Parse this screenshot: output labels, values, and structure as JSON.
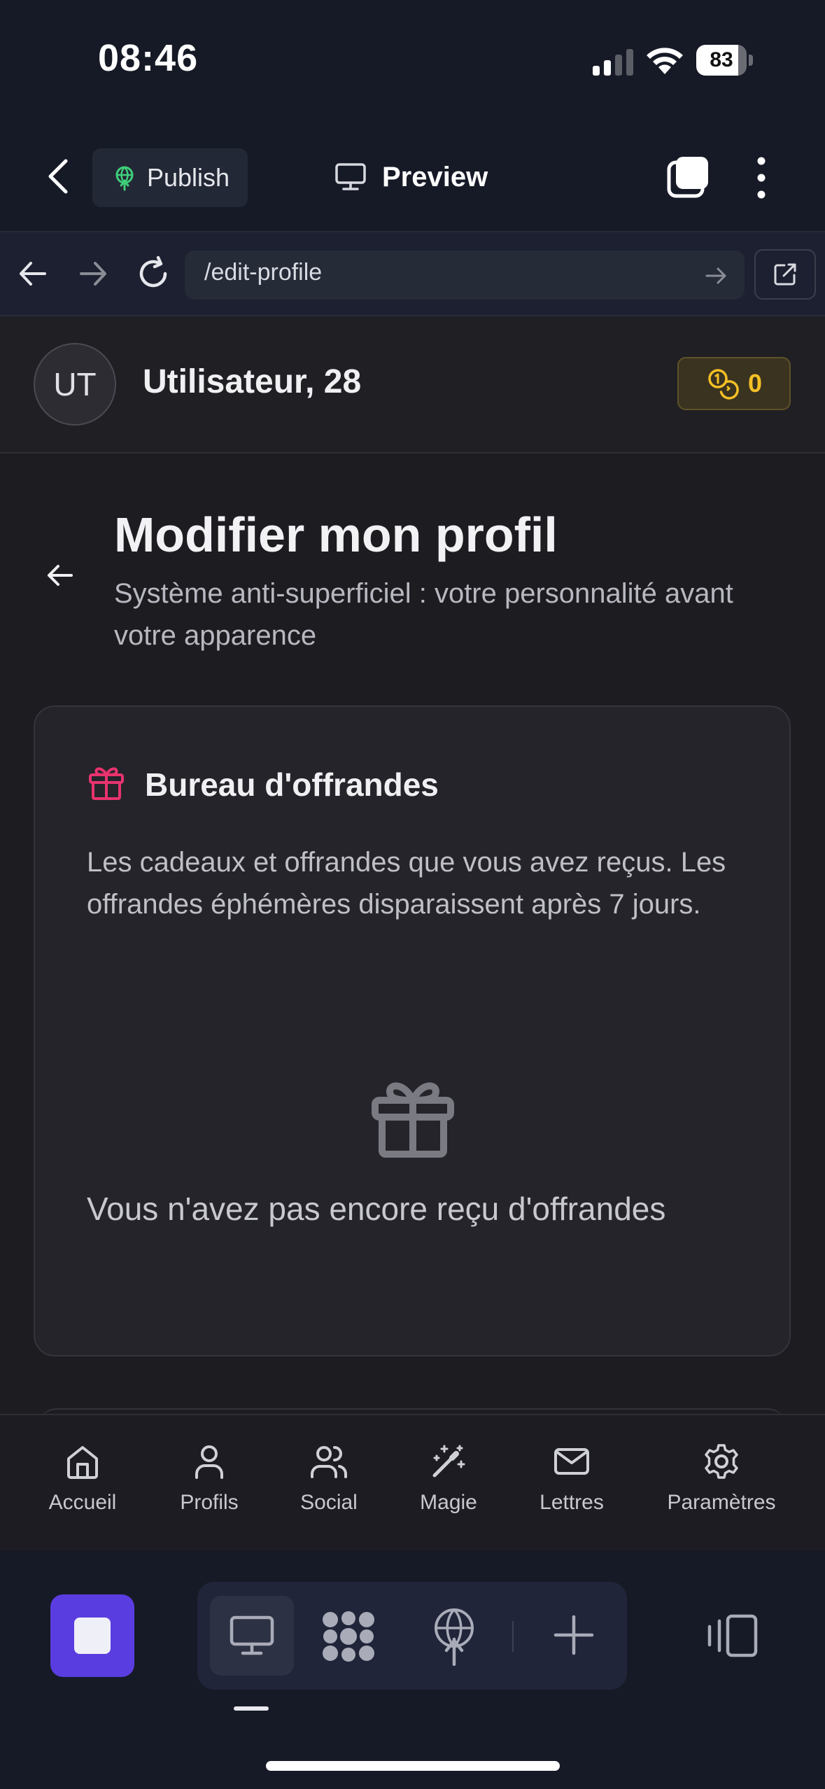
{
  "status": {
    "time": "08:46",
    "battery": "83",
    "battery_level": 0.83
  },
  "header": {
    "publish_label": "Publish",
    "preview_label": "Preview"
  },
  "browser": {
    "url": "/edit-profile"
  },
  "user": {
    "initials": "UT",
    "name": "Utilisateur, 28",
    "coins": "0"
  },
  "page": {
    "title": "Modifier mon profil",
    "subtitle": "Système anti-superficiel : votre personnalité avant votre apparence"
  },
  "card": {
    "title": "Bureau d'offrandes",
    "description": "Les cadeaux et offrandes que vous avez reçus. Les offrandes éphémères disparaissent après 7 jours.",
    "empty_text": "Vous n'avez pas encore reçu d'offrandes"
  },
  "nav": {
    "items": [
      {
        "label": "Accueil",
        "icon": "home-icon"
      },
      {
        "label": "Profils",
        "icon": "user-icon"
      },
      {
        "label": "Social",
        "icon": "users-icon"
      },
      {
        "label": "Magie",
        "icon": "magic-wand-icon"
      },
      {
        "label": "Lettres",
        "icon": "mail-icon"
      },
      {
        "label": "Paramètres",
        "icon": "gear-icon"
      }
    ]
  },
  "colors": {
    "accent_purple": "#5a3de0",
    "gift_pink": "#e8336e",
    "coin_yellow": "#f4c025",
    "publish_green": "#3ecf7a"
  }
}
